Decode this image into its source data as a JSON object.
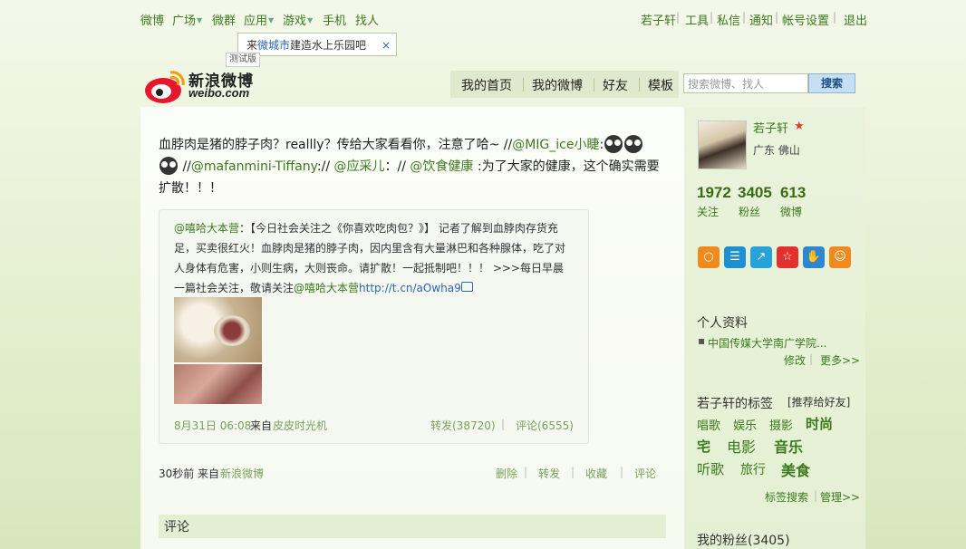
{
  "topnav": {
    "items": [
      {
        "label": "微博",
        "caret": false
      },
      {
        "label": "广场",
        "caret": true
      },
      {
        "label": "微群",
        "caret": false
      },
      {
        "label": "应用",
        "caret": true
      },
      {
        "label": "游戏",
        "caret": true
      },
      {
        "label": "手机",
        "caret": false
      },
      {
        "label": "找人",
        "caret": false
      }
    ],
    "right": [
      "若子轩",
      "工具",
      "私信",
      "通知",
      "帐号设置",
      "退出"
    ]
  },
  "popup": {
    "prefix": "来",
    "link": "微城市",
    "suffix": "建造水上乐园吧",
    "close": "×"
  },
  "beta_label": "测试版",
  "logo": {
    "cn": "新浪微博",
    "en": "weibo.com"
  },
  "mainnav": [
    "我的首页",
    "我的微博",
    "好友",
    "模板"
  ],
  "search": {
    "placeholder": "搜索微博、找人",
    "button": "搜索"
  },
  "post": {
    "text1": "血脖肉是猪的脖子肉？reallly？传给大家看看你，注意了哈~ //",
    "mention1": "@MIG_ice小睫",
    "colon": ":",
    "slashes": "//",
    "mention2": "@mafanmini-Tiffany",
    "sep2": ":// ",
    "mention3": "@应采儿",
    "sep3": "：// ",
    "mention4": "@饮食健康",
    "text2": " :为了大家的健康，这个确实需要扩散！！！"
  },
  "quote": {
    "author": "@嘻哈大本营",
    "text": "：【今日社会关注之《你喜欢吃肉包？》】 记者了解到血脖肉存货充足，买卖很红火！血脖肉是猪的脖子肉，因内里含有大量淋巴和各种腺体，吃了对人身体有危害，小则生病，大则丧命。请扩散！一起抵制吧！！！ >>>每日早晨一篇社会关注，敬请关注",
    "author2": "@嘻哈大本营",
    "link": "http://t.cn/aOwha9",
    "date": "8月31日",
    "time": "06:08",
    "from_label": "来自",
    "source": "皮皮时光机",
    "repost": "转发(38720)",
    "comment": "评论(6555)"
  },
  "post_meta": {
    "time": "30秒前",
    "from_label": "来自",
    "source": "新浪微博",
    "actions": [
      "删除",
      "转发",
      "收藏",
      "评论"
    ]
  },
  "comments_title": "评论",
  "sidebar": {
    "name": "若子轩",
    "vip": "★",
    "location": "广东  佛山",
    "stats": [
      {
        "value": "1972",
        "label": "关注"
      },
      {
        "value": "3405",
        "label": "粉丝"
      },
      {
        "value": "613",
        "label": "微博"
      }
    ],
    "app_icons": [
      {
        "name": "circle-app-icon",
        "color": "#f08a1c",
        "glyph": "○"
      },
      {
        "name": "list-app-icon",
        "color": "#1e8fd3",
        "glyph": "☰"
      },
      {
        "name": "map-app-icon",
        "color": "#27a2d8",
        "glyph": "↗"
      },
      {
        "name": "star-app-icon",
        "color": "#e2302d",
        "glyph": "☆"
      },
      {
        "name": "hand-app-icon",
        "color": "#2f86d0",
        "glyph": "✋"
      },
      {
        "name": "smile-app-icon",
        "color": "#f08a1c",
        "glyph": "☺"
      }
    ],
    "profile_title": "个人资料",
    "profile_item": "中国传媒大学南广学院...",
    "profile_links": [
      "修改",
      "更多>>"
    ],
    "tags_title": "若子轩的标签",
    "tags_recommend": "[推荐给好友]",
    "tags": [
      "唱歌",
      "娱乐",
      "摄影",
      "时尚",
      "宅",
      "电影",
      "音乐",
      "听歌",
      "旅行",
      "美食"
    ],
    "tag_links": [
      "标签搜索",
      "管理>>"
    ],
    "fans": "我的粉丝(3405)"
  }
}
